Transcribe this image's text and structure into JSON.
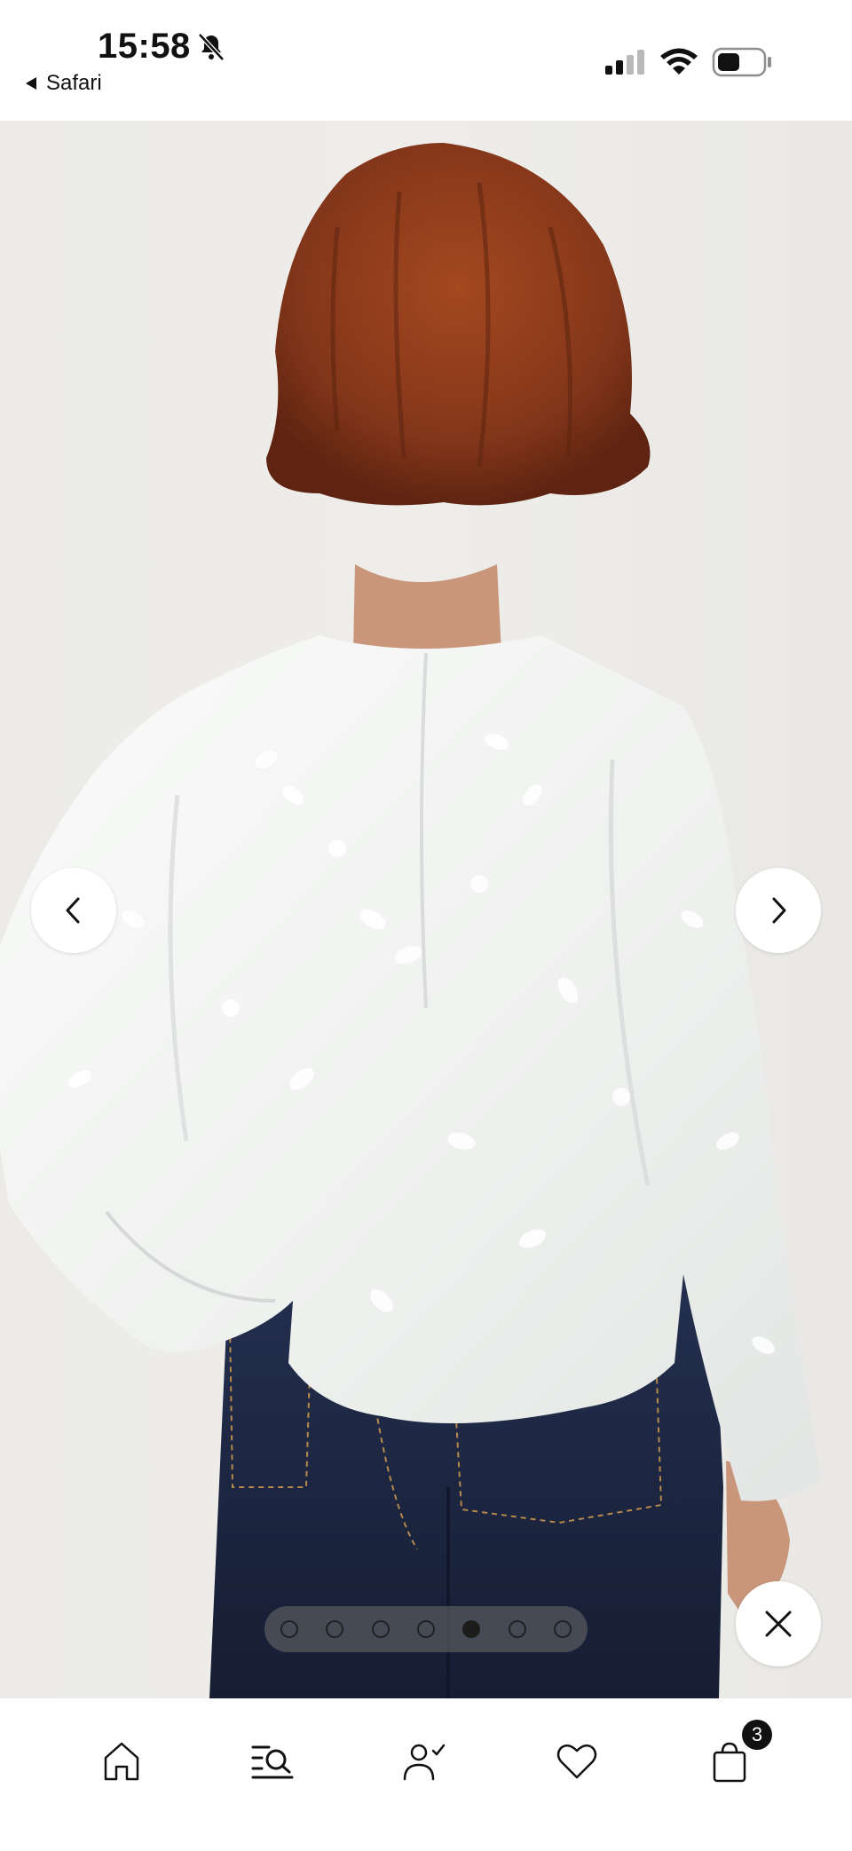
{
  "status_bar": {
    "time": "15:58",
    "back_app_label": "Safari",
    "icons": [
      "bell-slash-icon",
      "signal-icon",
      "wifi-icon",
      "battery-icon"
    ]
  },
  "gallery": {
    "image_description_icon": "product-photo",
    "prev_icon": "chevron-left-icon",
    "next_icon": "chevron-right-icon",
    "close_icon": "close-icon",
    "total_images": 7,
    "active_index": 4
  },
  "tab_bar": {
    "items": [
      {
        "name": "home",
        "icon": "home-icon"
      },
      {
        "name": "search",
        "icon": "search-icon"
      },
      {
        "name": "account",
        "icon": "account-icon"
      },
      {
        "name": "wishlist",
        "icon": "heart-icon"
      },
      {
        "name": "bag",
        "icon": "shopping-bag-icon"
      }
    ],
    "bag_count": "3"
  },
  "colors": {
    "background": "#ffffff",
    "photo_backdrop": "#ecebe8",
    "blouse": "#f5f6f4",
    "hair": "#8a3b1c",
    "jeans": "#1d2640",
    "dots_bg": "#8a8a8a"
  }
}
